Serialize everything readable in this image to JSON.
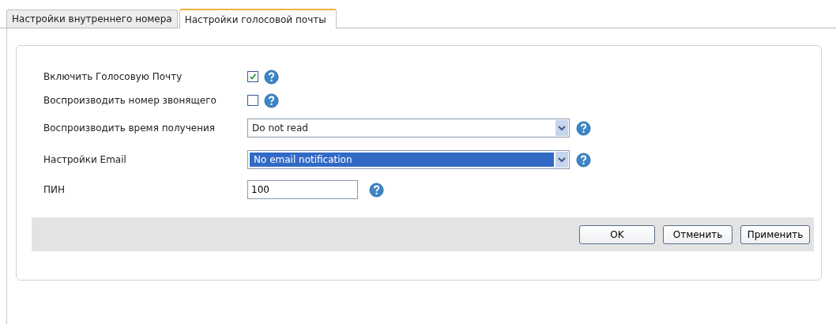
{
  "tabs": [
    {
      "label": "Настройки внутреннего номера",
      "selected": false
    },
    {
      "label": "Настройки голосовой почты",
      "selected": true
    }
  ],
  "fields": [
    {
      "kind": "checkbox",
      "label": "Включить Голосовую Почту",
      "checked": true
    },
    {
      "kind": "checkbox",
      "label": "Воспроизводить номер звонящего",
      "checked": false
    },
    {
      "kind": "select",
      "label": "Воспроизводить время получения",
      "value": "Do not read",
      "focused": false
    },
    {
      "kind": "select",
      "label": "Настройки Email",
      "value": "No email notification",
      "focused": true
    },
    {
      "kind": "text",
      "label": "ПИН",
      "value": "100"
    }
  ],
  "buttons": [
    "OK",
    "Отменить",
    "Применить"
  ]
}
